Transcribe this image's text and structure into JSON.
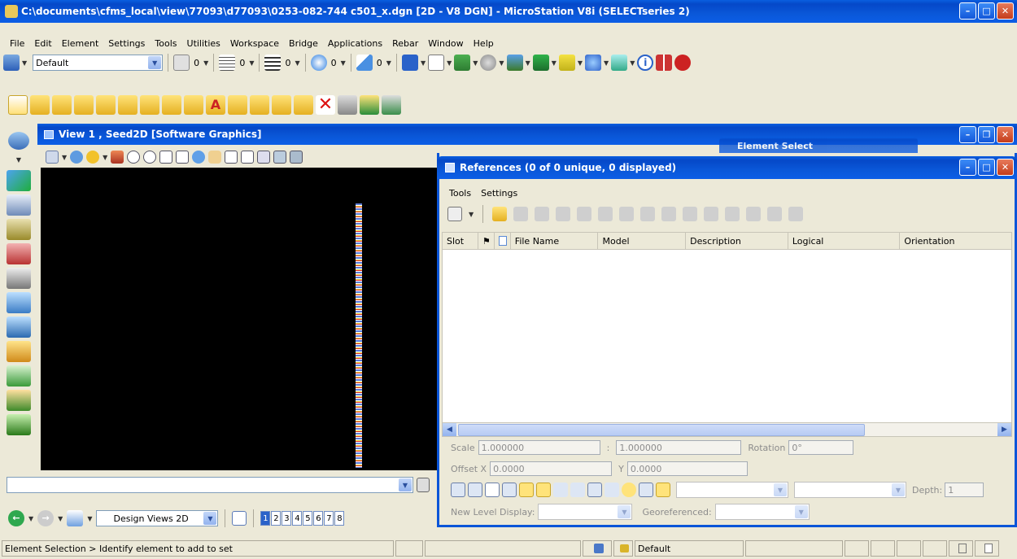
{
  "app": {
    "title": "C:\\documents\\cfms_local\\view\\77093\\d77093\\0253-082-744 c501_x.dgn [2D - V8 DGN] - MicroStation V8i (SELECTseries 2)"
  },
  "menu": [
    "File",
    "Edit",
    "Element",
    "Settings",
    "Tools",
    "Utilities",
    "Workspace",
    "Bridge",
    "Applications",
    "Rebar",
    "Window",
    "Help"
  ],
  "attributes": {
    "level_value": "Default",
    "color_value": "0",
    "style_value": "0",
    "weight_value": "0",
    "transparency_value": "0",
    "priority_value": "0"
  },
  "view1": {
    "title": "View 1 , Seed2D [Software Graphics]"
  },
  "element_select": {
    "title": "Element Select"
  },
  "references": {
    "title": "References (0 of 0 unique, 0 displayed)",
    "menu": [
      "Tools",
      "Settings"
    ],
    "columns": [
      "Slot",
      "",
      "",
      "File Name",
      "Model",
      "Description",
      "Logical",
      "Orientation"
    ],
    "scale_label": "Scale",
    "scale_value1": "1.000000",
    "scale_sep": ":",
    "scale_value2": "1.000000",
    "rotation_label": "Rotation",
    "rotation_value": "0°",
    "offset_label": "Offset X",
    "offset_x_value": "0.0000",
    "offset_y_label": "Y",
    "offset_y_value": "0.0000",
    "depth_label": "Depth:",
    "depth_value": "1",
    "new_level_label": "New Level Display:",
    "georef_label": "Georeferenced:"
  },
  "viewgroup": {
    "name": "Design Views 2D",
    "views": [
      "1",
      "2",
      "3",
      "4",
      "5",
      "6",
      "7",
      "8"
    ]
  },
  "status": {
    "message": "Element Selection > Identify element to add to set",
    "level": "Default"
  }
}
